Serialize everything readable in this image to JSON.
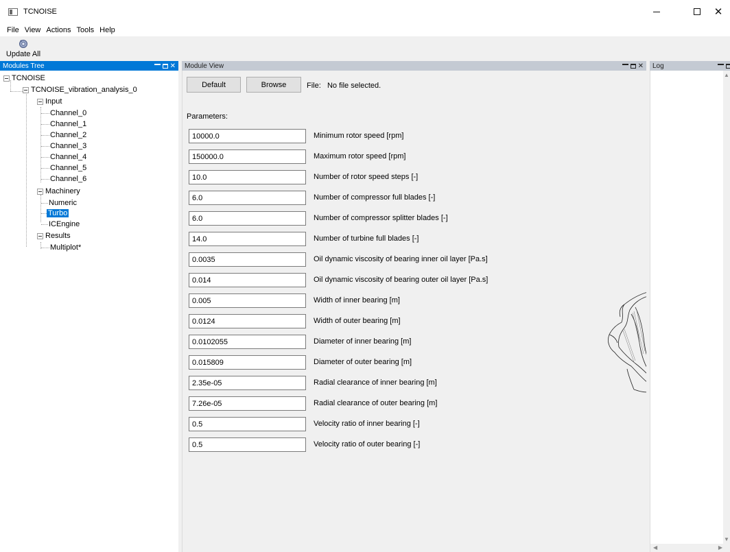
{
  "window": {
    "title": "TCNOISE",
    "controls": {
      "minimize": "—",
      "maximize": "□",
      "close": "✕"
    }
  },
  "menu": [
    "File",
    "View",
    "Actions",
    "Tools",
    "Help"
  ],
  "toolbar": {
    "update_all_label": "Update All",
    "update_all_icon": "gear-refresh-icon"
  },
  "modules_tree": {
    "title": "Modules Tree",
    "nodes": {
      "root": "TCNOISE",
      "analysis": "TCNOISE_vibration_analysis_0",
      "input": "Input",
      "channels": [
        "Channel_0",
        "Channel_1",
        "Channel_2",
        "Channel_3",
        "Channel_4",
        "Channel_5",
        "Channel_6"
      ],
      "machinery": "Machinery",
      "machinery_items": [
        "Numeric",
        "Turbo",
        "ICEngine"
      ],
      "results": "Results",
      "results_items": [
        "Multiplot*"
      ]
    },
    "selected": "Turbo"
  },
  "module_view": {
    "title": "Module View",
    "default_button": "Default",
    "browse_button": "Browse",
    "file_label": "File:",
    "file_value": "No file selected.",
    "parameters_header": "Parameters:",
    "parameters": [
      {
        "value": "10000.0",
        "label": "Minimum rotor speed [rpm]"
      },
      {
        "value": "150000.0",
        "label": "Maximum rotor speed [rpm]"
      },
      {
        "value": "10.0",
        "label": "Number of rotor speed steps [-]"
      },
      {
        "value": "6.0",
        "label": "Number of compressor full blades [-]"
      },
      {
        "value": "6.0",
        "label": "Number of compressor splitter blades [-]"
      },
      {
        "value": "14.0",
        "label": "Number of turbine full blades [-]"
      },
      {
        "value": "0.0035",
        "label": "Oil dynamic viscosity of bearing inner oil layer [Pa.s]"
      },
      {
        "value": "0.014",
        "label": "Oil dynamic viscosity of bearing outer oil layer [Pa.s]"
      },
      {
        "value": "0.005",
        "label": "Width of inner bearing  [m]"
      },
      {
        "value": "0.0124",
        "label": "Width of outer bearing  [m]"
      },
      {
        "value": "0.0102055",
        "label": "Diameter of inner bearing  [m]"
      },
      {
        "value": "0.015809",
        "label": "Diameter of outer bearing  [m]"
      },
      {
        "value": "2.35e-05",
        "label": "Radial clearance of inner bearing [m]"
      },
      {
        "value": "7.26e-05",
        "label": "Radial clearance of outer bearing [m]"
      },
      {
        "value": "0.5",
        "label": "Velocity ratio of inner bearing [-]"
      },
      {
        "value": "0.5",
        "label": "Velocity ratio of outer bearing [-]"
      }
    ]
  },
  "log": {
    "title": "Log"
  },
  "colors": {
    "selection": "#0078d7",
    "dock_header": "#c4cad3",
    "background": "#f0f0f0"
  }
}
